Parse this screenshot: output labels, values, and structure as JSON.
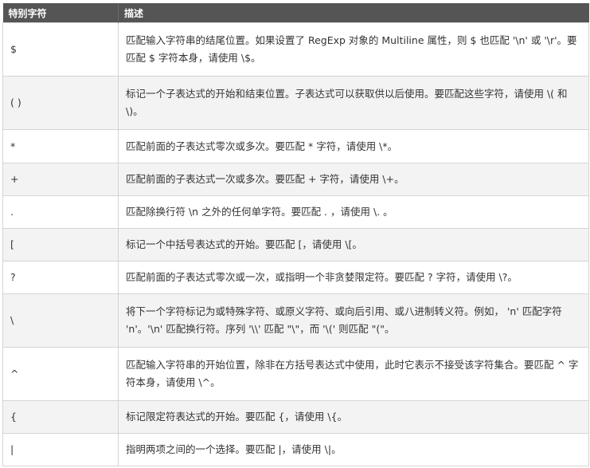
{
  "table": {
    "headers": [
      "特别字符",
      "描述"
    ],
    "rows": [
      {
        "char": "$",
        "desc": "匹配输入字符串的结尾位置。如果设置了 RegExp 对象的 Multiline 属性，则 $ 也匹配 '\\n' 或 '\\r'。要匹配 $ 字符本身，请使用 \\$。"
      },
      {
        "char": "( )",
        "desc": "标记一个子表达式的开始和结束位置。子表达式可以获取供以后使用。要匹配这些字符，请使用 \\( 和 \\)。"
      },
      {
        "char": "*",
        "desc": "匹配前面的子表达式零次或多次。要匹配 * 字符，请使用 \\*。"
      },
      {
        "char": "+",
        "desc": "匹配前面的子表达式一次或多次。要匹配 + 字符，请使用 \\+。"
      },
      {
        "char": ".",
        "desc": "匹配除换行符 \\n 之外的任何单字符。要匹配 . ，请使用 \\. 。"
      },
      {
        "char": "[",
        "desc": "标记一个中括号表达式的开始。要匹配 [，请使用 \\[。"
      },
      {
        "char": "?",
        "desc": "匹配前面的子表达式零次或一次，或指明一个非贪婪限定符。要匹配 ? 字符，请使用 \\?。"
      },
      {
        "char": "\\",
        "desc": "将下一个字符标记为或特殊字符、或原义字符、或向后引用、或八进制转义符。例如， 'n' 匹配字符 'n'。'\\n' 匹配换行符。序列 '\\\\' 匹配 \"\\\"，而 '\\(' 则匹配 \"(\"。"
      },
      {
        "char": "^",
        "desc": "匹配输入字符串的开始位置，除非在方括号表达式中使用，此时它表示不接受该字符集合。要匹配 ^ 字符本身，请使用 \\^。"
      },
      {
        "char": "{",
        "desc": "标记限定符表达式的开始。要匹配 {，请使用 \\{。"
      },
      {
        "char": "|",
        "desc": "指明两项之间的一个选择。要匹配 |，请使用 \\|。"
      }
    ]
  }
}
